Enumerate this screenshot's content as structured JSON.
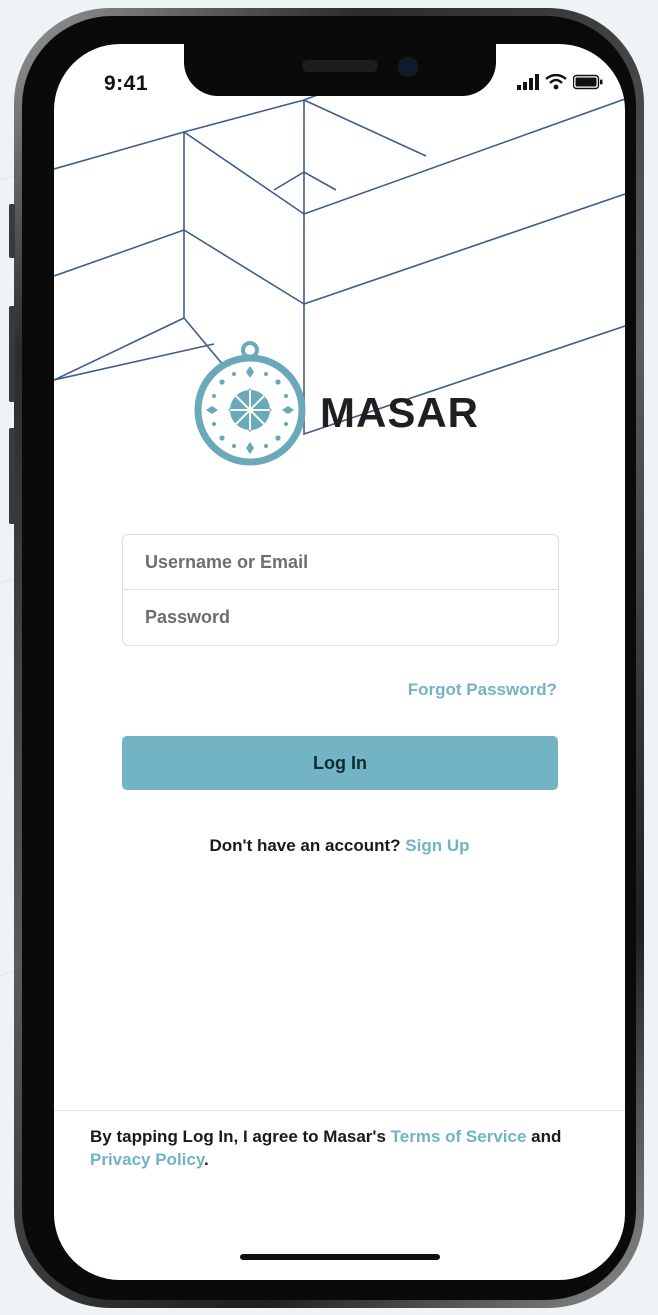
{
  "status_bar": {
    "time": "9:41",
    "icons": [
      "cellular-signal-icon",
      "wifi-icon",
      "battery-icon"
    ]
  },
  "brand": {
    "name": "MASAR",
    "logo_icon": "compass-icon",
    "accent_color": "#72b3c4"
  },
  "login_form": {
    "username_placeholder": "Username or Email",
    "username_value": "",
    "password_placeholder": "Password",
    "password_value": "",
    "forgot_password_label": "Forgot Password?",
    "login_button_label": "Log In"
  },
  "signup": {
    "prompt": "Don't have an account?",
    "link_label": "Sign Up"
  },
  "legal": {
    "prefix": "By tapping Log In, I agree to Masar's",
    "terms_label": "Terms of Service",
    "conjunction": "and",
    "privacy_label": "Privacy Policy",
    "suffix": "."
  }
}
